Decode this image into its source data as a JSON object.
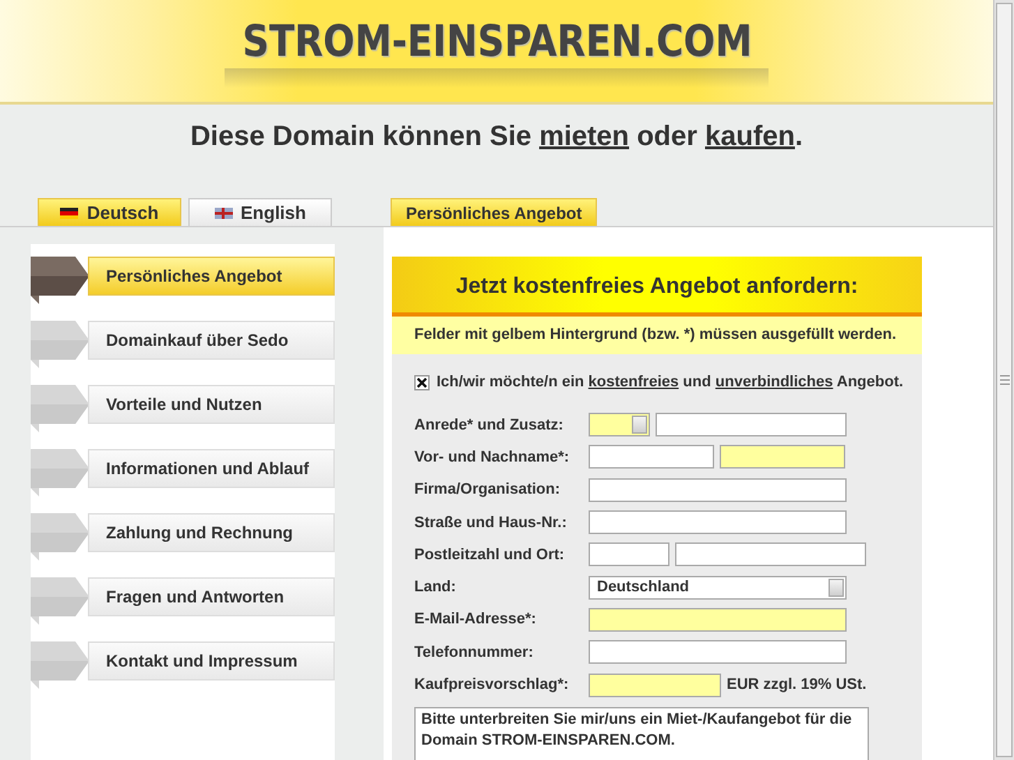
{
  "header": {
    "logo": "STROM-EINSPAREN.COM"
  },
  "headline": [
    {
      "kind": "text",
      "text": "Diese Domain können Sie "
    },
    {
      "kind": "link",
      "text": "mieten"
    },
    {
      "kind": "text",
      "text": " oder "
    },
    {
      "kind": "link",
      "text": "kaufen"
    },
    {
      "kind": "text",
      "text": "."
    }
  ],
  "language_tabs": [
    {
      "label": "Deutsch",
      "selected": true
    },
    {
      "label": "English",
      "selected": false
    }
  ],
  "content_tab": {
    "label": "Persönliches Angebot"
  },
  "sidebar": {
    "items": [
      {
        "label": "Persönliches Angebot",
        "selected": true
      },
      {
        "label": "Domainkauf über Sedo",
        "selected": false
      },
      {
        "label": "Vorteile und Nutzen",
        "selected": false
      },
      {
        "label": "Informationen und Ablauf",
        "selected": false
      },
      {
        "label": "Zahlung und Rechnung",
        "selected": false
      },
      {
        "label": "Fragen und Antworten",
        "selected": false
      },
      {
        "label": "Kontakt und Impressum",
        "selected": false
      }
    ]
  },
  "form": {
    "title": "Jetzt kostenfreies Angebot anfordern:",
    "note": "Felder mit gelbem Hintergrund (bzw. *) müssen ausgefüllt werden.",
    "consent": {
      "checked": true,
      "label": [
        {
          "kind": "text",
          "text": "Ich/wir möchte/n ein "
        },
        {
          "kind": "link",
          "text": "kostenfreies"
        },
        {
          "kind": "text",
          "text": " und "
        },
        {
          "kind": "link",
          "text": "unverbindliches"
        },
        {
          "kind": "text",
          "text": " Angebot."
        }
      ]
    },
    "rows": [
      {
        "label": "Anrede* und Zusatz:",
        "inputs": [
          {
            "kind": "select",
            "required": true
          },
          {
            "kind": "text",
            "required": false
          }
        ]
      },
      {
        "label": "Vor- und Nachname*:",
        "inputs": [
          {
            "kind": "text",
            "required": false
          },
          {
            "kind": "text",
            "required": true
          }
        ]
      },
      {
        "label": "Firma/Organisation:",
        "inputs": [
          {
            "kind": "text",
            "required": false
          }
        ]
      },
      {
        "label": "Straße und Haus-Nr.:",
        "inputs": [
          {
            "kind": "text",
            "required": false
          }
        ]
      },
      {
        "label": "Postleitzahl und Ort:",
        "inputs": [
          {
            "kind": "text",
            "required": false
          },
          {
            "kind": "text",
            "required": false
          }
        ]
      },
      {
        "label": "Land:",
        "inputs": [
          {
            "kind": "select",
            "required": false,
            "value": "Deutschland"
          }
        ]
      },
      {
        "label": "E-Mail-Adresse*:",
        "inputs": [
          {
            "kind": "text",
            "required": true
          }
        ]
      },
      {
        "label": "Telefonnummer:",
        "inputs": [
          {
            "kind": "text",
            "required": false
          }
        ]
      },
      {
        "label": "Kaufpreisvorschlag*:",
        "inputs": [
          {
            "kind": "text",
            "required": true
          }
        ],
        "suffix": "EUR zzgl. 19% USt."
      }
    ],
    "message": "Bitte unterbreiten Sie mir/uns ein Miet-/Kaufangebot für die Domain STROM-EINSPAREN.COM."
  }
}
